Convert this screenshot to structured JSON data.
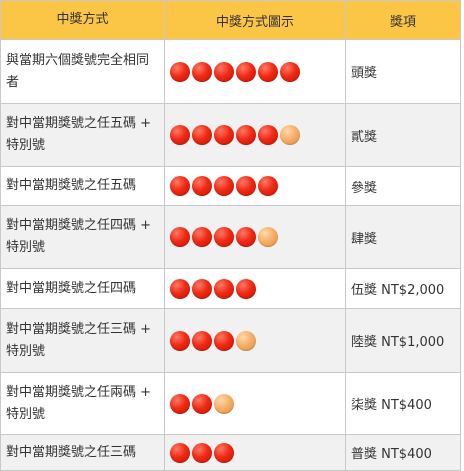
{
  "header": {
    "col_method": "中獎方式",
    "col_diagram": "中獎方式圖示",
    "col_prize": "獎項"
  },
  "rows": [
    {
      "method": "與當期六個獎號完全相同者",
      "red_balls": 6,
      "special_balls": 0,
      "prize": "頭獎"
    },
    {
      "method": "對中當期獎號之任五碼 + 特別號",
      "red_balls": 5,
      "special_balls": 1,
      "prize": "貳獎"
    },
    {
      "method": "對中當期獎號之任五碼",
      "red_balls": 5,
      "special_balls": 0,
      "prize": "參獎"
    },
    {
      "method": "對中當期獎號之任四碼 + 特別號",
      "red_balls": 4,
      "special_balls": 1,
      "prize": "肆獎"
    },
    {
      "method": "對中當期獎號之任四碼",
      "red_balls": 4,
      "special_balls": 0,
      "prize": "伍獎 NT$2,000"
    },
    {
      "method": "對中當期獎號之任三碼 + 特別號",
      "red_balls": 3,
      "special_balls": 1,
      "prize": "陸獎 NT$1,000"
    },
    {
      "method": "對中當期獎號之任兩碼 + 特別號",
      "red_balls": 2,
      "special_balls": 1,
      "prize": "柒獎  NT$400"
    },
    {
      "method": "對中當期獎號之任三碼",
      "red_balls": 3,
      "special_balls": 0,
      "prize": "普獎 NT$400"
    }
  ],
  "colors": {
    "header_bg": "#fbc645",
    "ball_red": "#ef2a14",
    "ball_special": "#f4ab63",
    "row_alt": "#f1f1f1"
  },
  "icons": {
    "regular_ball": "red-ball-icon",
    "special_ball": "special-ball-icon"
  }
}
